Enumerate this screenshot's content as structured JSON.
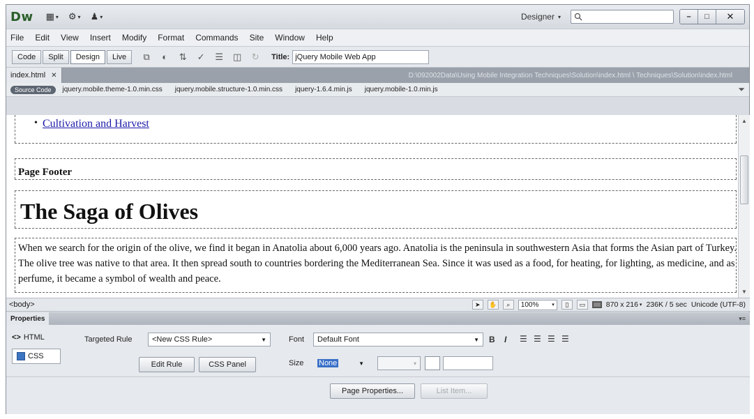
{
  "app": {
    "logo": "Dw"
  },
  "titlebar": {
    "workspace_label": "Designer",
    "search_placeholder": "",
    "minimize": "–",
    "maximize": "□",
    "close": "✕"
  },
  "menu": [
    "File",
    "Edit",
    "View",
    "Insert",
    "Modify",
    "Format",
    "Commands",
    "Site",
    "Window",
    "Help"
  ],
  "doc_toolbar": {
    "views": [
      "Code",
      "Split",
      "Design",
      "Live"
    ],
    "active_view": "Design",
    "title_label": "Title:",
    "title_value": "jQuery Mobile Web App"
  },
  "file_tab": {
    "name": "index.html",
    "path": "D:\\092002Data\\Using Mobile Integration Techniques\\Solution\\index.html  \\ Techniques\\Solution\\index.html"
  },
  "related_files": {
    "source_label": "Source Code",
    "files": [
      "jquery.mobile.theme-1.0.min.css",
      "jquery.mobile.structure-1.0.min.css",
      "jquery-1.6.4.min.js",
      "jquery.mobile-1.0.min.js"
    ]
  },
  "design": {
    "list_item": "Cultivation and Harvest",
    "footer": "Page Footer",
    "heading": "The Saga of Olives",
    "paragraph": "When we search for the origin of the olive, we find it began in Anatolia about 6,000 years ago. Anatolia is the peninsula in southwestern Asia that forms the Asian part of Turkey. The olive tree was native to that area. It then spread south to countries bordering the Mediterranean Sea. Since it was used as a food, for heating, for lighting, as medicine, and as perfume, it became a symbol of wealth and peace."
  },
  "status": {
    "tag": "<body>",
    "zoom": "100%",
    "dimensions": "870 x 216",
    "download": "236K / 5 sec",
    "encoding": "Unicode (UTF-8)"
  },
  "properties": {
    "tab": "Properties",
    "html_mode": "HTML",
    "css_mode": "CSS",
    "targeted_rule_label": "Targeted Rule",
    "targeted_rule_value": "<New CSS Rule>",
    "edit_rule": "Edit Rule",
    "css_panel": "CSS Panel",
    "font_label": "Font",
    "font_value": "Default Font",
    "size_label": "Size",
    "size_value": "None",
    "bold": "B",
    "italic": "I",
    "page_properties": "Page Properties...",
    "list_item": "List Item..."
  }
}
